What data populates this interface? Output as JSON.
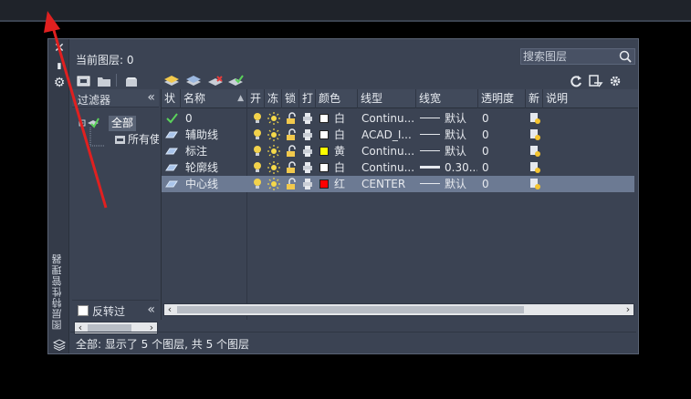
{
  "window": {
    "current_layer_label": "当前图层: 0",
    "palette_title": "图层特性管理器",
    "search_placeholder": "搜索图层",
    "status_text": "全部: 显示了 5 个图层, 共 5 个图层"
  },
  "filters": {
    "header": "过滤器",
    "collapse": "«",
    "tree_root": "全部",
    "tree_child": "所有使用的图层",
    "invert_label": "反转过",
    "invert_checked": false
  },
  "columns": [
    "状",
    "名称",
    "开",
    "冻",
    "锁",
    "打",
    "颜色",
    "线型",
    "线宽",
    "透明度",
    "新",
    "说明"
  ],
  "layers": [
    {
      "status": "current",
      "name": "0",
      "color_name": "白",
      "color_hex": "#ffffff",
      "linetype": "Continu...",
      "lineweight": "默认",
      "lw_heavy": false,
      "transparency": "0",
      "selected": false
    },
    {
      "status": "layer",
      "name": "辅助线",
      "color_name": "白",
      "color_hex": "#ffffff",
      "linetype": "ACAD_I...",
      "lineweight": "默认",
      "lw_heavy": false,
      "transparency": "0",
      "selected": false
    },
    {
      "status": "layer",
      "name": "标注",
      "color_name": "黄",
      "color_hex": "#ffff00",
      "linetype": "Continu...",
      "lineweight": "默认",
      "lw_heavy": false,
      "transparency": "0",
      "selected": false
    },
    {
      "status": "layer",
      "name": "轮廓线",
      "color_name": "白",
      "color_hex": "#ffffff",
      "linetype": "Continu...",
      "lineweight": "0.30...",
      "lw_heavy": true,
      "transparency": "0",
      "selected": false
    },
    {
      "status": "layer",
      "name": "中心线",
      "color_name": "红",
      "color_hex": "#ff0000",
      "linetype": "CENTER",
      "lineweight": "默认",
      "lw_heavy": false,
      "transparency": "0",
      "selected": true
    }
  ],
  "colors": {
    "palette_bg": "#3b4353",
    "selected_row": "#6c7a93",
    "annotation_arrow": "#e02020",
    "bulb": "#f2d24b",
    "sun": "#f4d84a"
  },
  "icons": {
    "close": "close-icon",
    "settings": "gear-icon",
    "refresh": "refresh-icon",
    "search": "search-icon"
  }
}
